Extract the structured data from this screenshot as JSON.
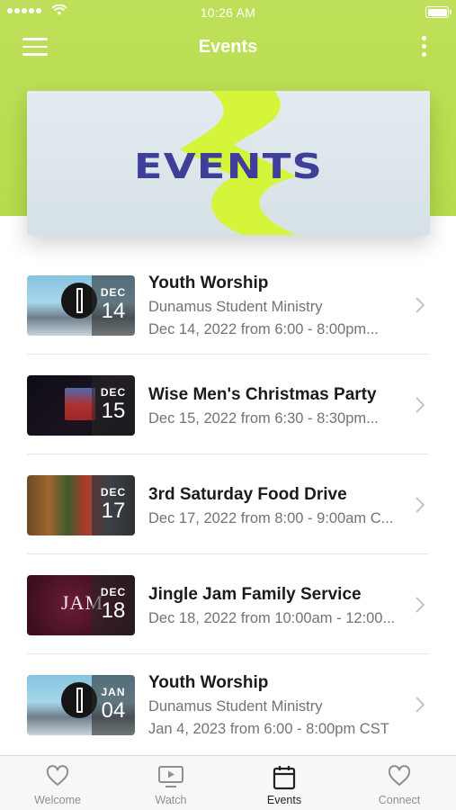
{
  "status_bar": {
    "time": "10:26 AM"
  },
  "header": {
    "title": "Events"
  },
  "banner": {
    "text": "EVENTS"
  },
  "events": [
    {
      "month": "DEC",
      "day": "14",
      "title": "Youth Worship",
      "subtitle": "Dunamus Student Ministry",
      "when": "Dec 14, 2022 from 6:00 - 8:00pm..."
    },
    {
      "month": "DEC",
      "day": "15",
      "title": "Wise Men's Christmas Party",
      "subtitle": "",
      "when": "Dec 15, 2022 from 6:30 - 8:30pm..."
    },
    {
      "month": "DEC",
      "day": "17",
      "title": "3rd Saturday Food Drive",
      "subtitle": "",
      "when": "Dec 17, 2022 from 8:00 - 9:00am C..."
    },
    {
      "month": "DEC",
      "day": "18",
      "title": "Jingle Jam Family Service",
      "subtitle": "",
      "when": "Dec 18, 2022 from 10:00am - 12:00..."
    },
    {
      "month": "JAN",
      "day": "04",
      "title": "Youth Worship",
      "subtitle": "Dunamus Student Ministry",
      "when": "Jan 4, 2023 from 6:00 - 8:00pm CST"
    }
  ],
  "tabs": [
    {
      "label": "Welcome",
      "icon": "heart-icon",
      "active": false
    },
    {
      "label": "Watch",
      "icon": "tv-play-icon",
      "active": false
    },
    {
      "label": "Events",
      "icon": "calendar-icon",
      "active": true
    },
    {
      "label": "Connect",
      "icon": "heart-icon",
      "active": false
    }
  ],
  "colors": {
    "header_green": "#b6dc4b",
    "banner_text": "#3f3f99",
    "banner_swoosh": "#d5f53a"
  }
}
